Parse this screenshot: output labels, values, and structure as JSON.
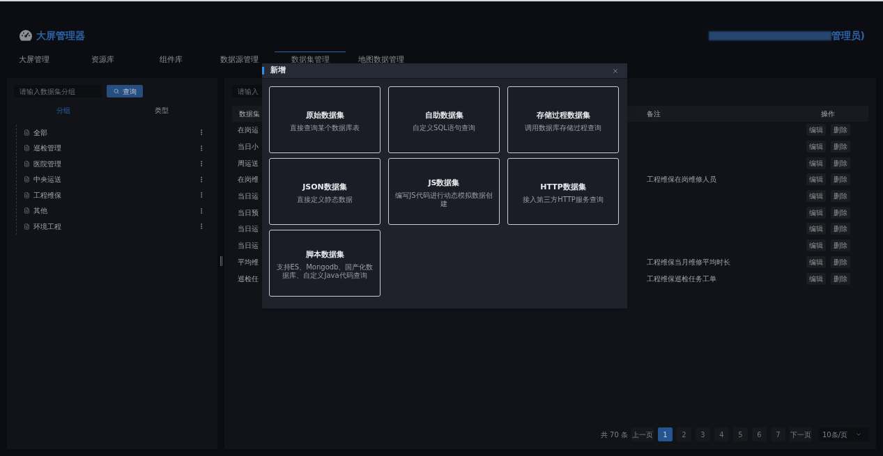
{
  "header": {
    "title": "大屏管理器",
    "user": "管理员)"
  },
  "nav_tabs": [
    {
      "label": "大屏管理",
      "selected": false
    },
    {
      "label": "资源库",
      "selected": false
    },
    {
      "label": "组件库",
      "selected": false
    },
    {
      "label": "数据源管理",
      "selected": false
    },
    {
      "label": "数据集管理",
      "selected": true
    },
    {
      "label": "地图数据管理",
      "selected": false
    }
  ],
  "group_panel": {
    "search": {
      "placeholder": "请输入数据集分组"
    },
    "search_button": "查询",
    "tabs": [
      {
        "label": "分组",
        "selected": true
      },
      {
        "label": "类型",
        "selected": false
      }
    ],
    "tree": [
      {
        "label": "全部"
      },
      {
        "label": "巡检管理"
      },
      {
        "label": "医院管理"
      },
      {
        "label": "中央运送"
      },
      {
        "label": "工程维保"
      },
      {
        "label": "其他"
      },
      {
        "label": "环境工程"
      }
    ]
  },
  "dataset_panel": {
    "search": {
      "placeholder": "请输入"
    },
    "table": {
      "columns": [
        "数据集",
        "备注",
        "操作"
      ],
      "rows": [
        {
          "name": "在岗运",
          "actions": [
            "编辑",
            "删除"
          ]
        },
        {
          "name": "当日小",
          "actions": [
            "编辑",
            "删除"
          ]
        },
        {
          "name": "周运送",
          "actions": [
            "编辑",
            "删除"
          ]
        },
        {
          "name": "在岗维",
          "remark": "工程维保在岗维修人员",
          "actions": [
            "编辑",
            "删除"
          ]
        },
        {
          "name": "当日运",
          "actions": [
            "编辑",
            "删除"
          ]
        },
        {
          "name": "当日预",
          "actions": [
            "编辑",
            "删除"
          ]
        },
        {
          "name": "当日运",
          "actions": [
            "编辑",
            "删除"
          ]
        },
        {
          "name": "当日运",
          "actions": [
            "编辑",
            "删除"
          ]
        },
        {
          "name": "平均维",
          "remark": "工程维保当月维修平均时长",
          "actions": [
            "编辑",
            "删除"
          ]
        },
        {
          "name": "巡检任",
          "remark": "工程维保巡检任务工单",
          "actions": [
            "编辑",
            "删除"
          ]
        }
      ]
    },
    "pagination": {
      "total": "共 70 条",
      "prev": "上一页",
      "pages": [
        {
          "label": "1",
          "selected": true
        },
        {
          "label": "2",
          "selected": false
        },
        {
          "label": "3",
          "selected": false
        },
        {
          "label": "4",
          "selected": false
        },
        {
          "label": "5",
          "selected": false
        },
        {
          "label": "6",
          "selected": false
        },
        {
          "label": "7",
          "selected": false
        }
      ],
      "next": "下一页",
      "page_size": "10条/页"
    }
  },
  "dialog": {
    "title": "新增",
    "cards": [
      {
        "title": "原始数据集",
        "description": "直接查询某个数据库表"
      },
      {
        "title": "自助数据集",
        "description": "自定义SQL语句查询"
      },
      {
        "title": "存储过程数据集",
        "description": "调用数据库存储过程查询"
      },
      {
        "title": "JSON数据集",
        "description": "直接定义静态数据"
      },
      {
        "title": "JS数据集",
        "description": "编写JS代码进行动态模拟数据创建"
      },
      {
        "title": "HTTP数据集",
        "description": "接入第三方HTTP服务查询"
      },
      {
        "title": "脚本数据集",
        "description": "支持ES、Mongodb、国产化数据库、自定义Java代码查询"
      }
    ]
  }
}
